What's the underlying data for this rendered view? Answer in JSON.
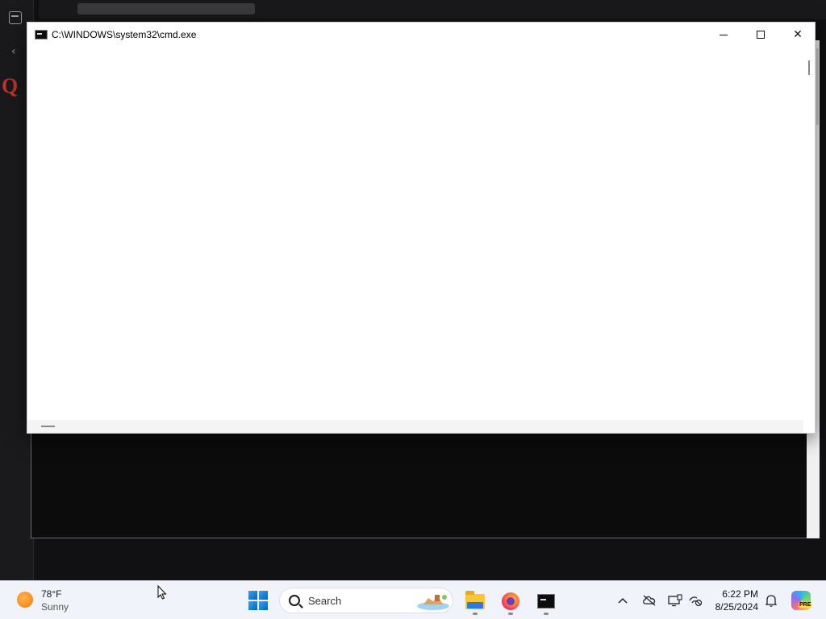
{
  "cmd_window": {
    "title": "C:\\WINDOWS\\system32\\cmd.exe",
    "minimize_glyph": "",
    "maximize_glyph": "",
    "close_glyph": "✕"
  },
  "taskbar": {
    "weather": {
      "temp": "78°F",
      "condition": "Sunny"
    },
    "search": {
      "label": "Search"
    },
    "apps": [
      {
        "name": "File Explorer",
        "icon": "folder-icon"
      },
      {
        "name": "Firefox",
        "icon": "firefox-icon"
      },
      {
        "name": "Command Prompt",
        "icon": "cmd-icon"
      }
    ],
    "tray": {
      "chevron": "^",
      "clock_time": "6:22 PM",
      "clock_date": "8/25/2024",
      "copilot_badge": "PRE"
    }
  },
  "colors": {
    "taskbar_bg": "#f0f3f9",
    "console_bg": "#0c0c0c",
    "window_bg": "#ffffff",
    "accent": "#0067c0"
  }
}
